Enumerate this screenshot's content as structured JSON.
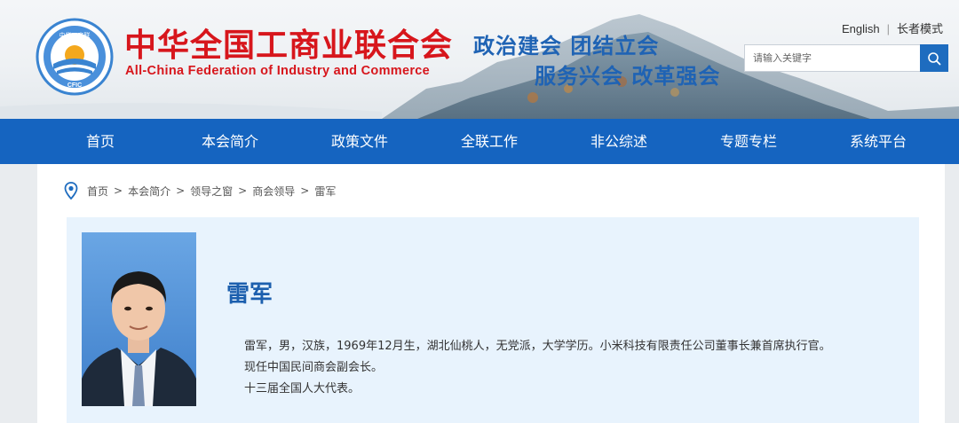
{
  "header": {
    "org_name_cn": "中华全国工商业联合会",
    "org_name_en": "All-China Federation of Industry and Commerce",
    "badge_top_text": "中华工商联",
    "badge_bottom_text": "CFIC",
    "slogan_line1": "政治建会 团结立会",
    "slogan_line2": "服务兴会 改革强会",
    "links": {
      "english": "English",
      "elder_mode": "长者模式"
    },
    "search": {
      "placeholder": "请输入关键字",
      "value": "",
      "icon": "search-icon"
    }
  },
  "nav": {
    "items": [
      "首页",
      "本会简介",
      "政策文件",
      "全联工作",
      "非公综述",
      "专题专栏",
      "系统平台"
    ]
  },
  "breadcrumb": {
    "icon": "location-pin-icon",
    "items": [
      "首页",
      "本会简介",
      "领导之窗",
      "商会领导",
      "雷军"
    ],
    "separator": ">"
  },
  "profile": {
    "name": "雷军",
    "bio": [
      "雷军，男，汉族，1969年12月生，湖北仙桃人，无党派，大学学历。小米科技有限责任公司董事长兼首席执行官。",
      "现任中国民间商会副会长。",
      "十三届全国人大代表。"
    ]
  },
  "colors": {
    "brand_red": "#d7161c",
    "brand_blue": "#1564c0",
    "slogan_blue": "#1f63b4",
    "profile_bg": "#e8f3fd"
  }
}
